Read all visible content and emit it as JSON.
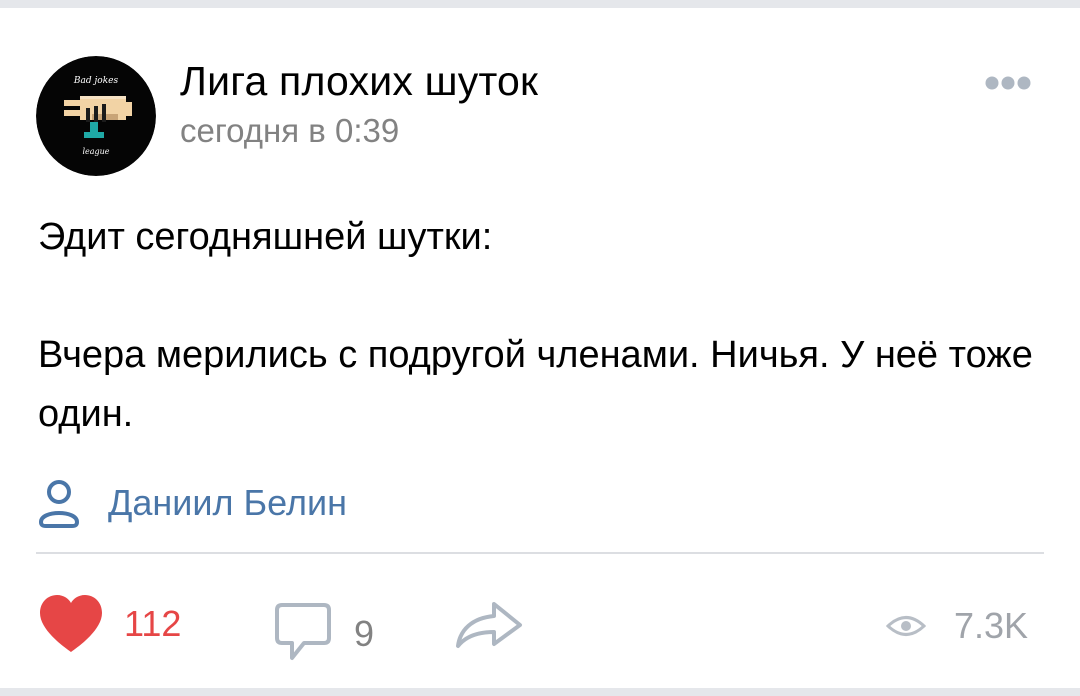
{
  "post": {
    "group_name": "Лига плохих шуток",
    "timestamp": "сегодня в 0:39",
    "text_line1": "Эдит сегодняшней шутки:",
    "text_line2": "Вчера мерились с подругой членами. Ничья. У неё тоже один.",
    "author": "Даниил Белин"
  },
  "avatar": {
    "logo_text_top": "Bad jokes",
    "logo_text_bottom": "league"
  },
  "actions": {
    "likes": "112",
    "comments": "9",
    "views": "7.3K"
  },
  "icons": {
    "more": "more-dots-icon",
    "author": "person-icon",
    "like": "heart-icon",
    "comment": "comment-bubble-icon",
    "share": "share-arrow-icon",
    "views": "eye-icon"
  },
  "colors": {
    "link": "#4a76a8",
    "like": "#e64646",
    "secondary_text": "#828282",
    "icon_gray": "#aeb7c2"
  }
}
